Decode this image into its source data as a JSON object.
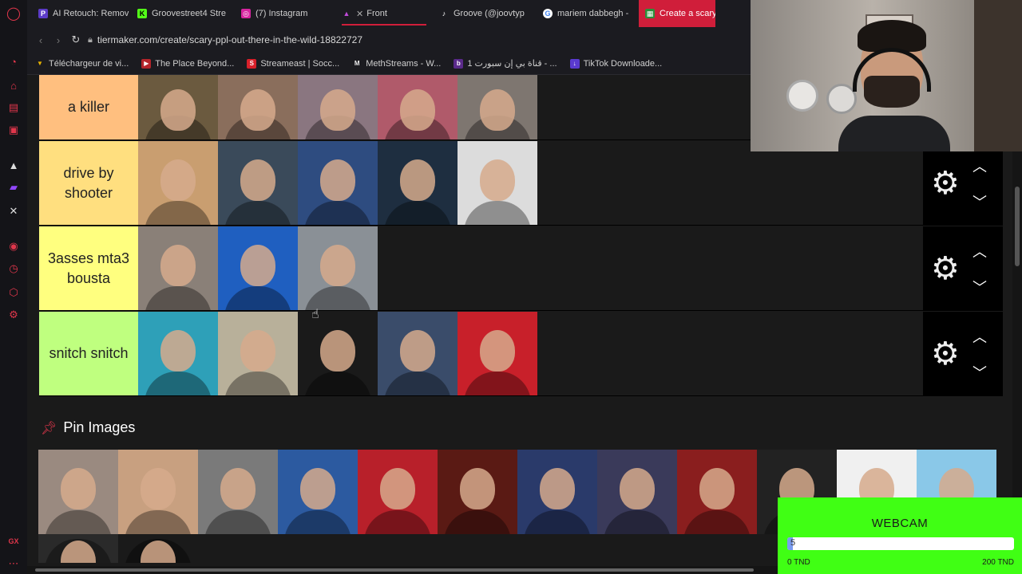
{
  "browser": {
    "tabs": [
      {
        "label": "AI Retouch: Remov",
        "icon": "picsart-icon",
        "color": "#5c3cc8"
      },
      {
        "label": "Groovestreet4 Stre",
        "icon": "kick-icon",
        "color": "#53fc18"
      },
      {
        "label": "(7) Instagram",
        "icon": "instagram-icon",
        "color": "#d6249f"
      },
      {
        "label": "Front",
        "icon": "front-icon",
        "color": "#c04ad8"
      },
      {
        "label": "Groove (@joovtyp",
        "icon": "tiktok-icon",
        "color": "#111111"
      },
      {
        "label": "mariem dabbegh -",
        "icon": "google-icon",
        "color": "#4285f4"
      },
      {
        "label": "Create a scary",
        "icon": "tiermaker-icon",
        "color": "#2d8f3a"
      }
    ],
    "url": "tiermaker.com/create/scary-ppl-out-there-in-the-wild-18822727",
    "bookmarks": [
      {
        "label": "Téléchargeur de vi...",
        "icon": "vidiq-icon",
        "color": "#e8b400"
      },
      {
        "label": "The Place Beyond...",
        "icon": "movie-icon",
        "color": "#b3242a"
      },
      {
        "label": "Streameast | Socc...",
        "icon": "streameast-icon",
        "color": "#d8202a"
      },
      {
        "label": "MethStreams - W...",
        "icon": "m-icon",
        "color": "#222"
      },
      {
        "label": "قناة بي إن سبورت 1 - ...",
        "icon": "bein-icon",
        "color": "#5a2a8a"
      },
      {
        "label": "TikTok Downloade...",
        "icon": "download-icon",
        "color": "#5a3ad0"
      }
    ]
  },
  "tiers": [
    {
      "label": "a killer",
      "color": "#ffbf7f",
      "images": [
        "#6b5a3f",
        "#8a6e5c",
        "#8a7680",
        "#b05a6a",
        "#7e7670"
      ]
    },
    {
      "label": "drive by shooter",
      "color": "#ffdf7f",
      "images": [
        "#c99e70",
        "#3a4a5a",
        "#2e4c80",
        "#1e2e40",
        "#dcdcdc"
      ]
    },
    {
      "label": "3asses mta3 bousta",
      "color": "#ffff7f",
      "images": [
        "#8a8078",
        "#1f5fc0",
        "#8a9096"
      ]
    },
    {
      "label": "snitch snitch",
      "color": "#bfff7f",
      "images": [
        "#2ea0b8",
        "#b8b09a",
        "#1a1a1a",
        "#3a4c6a",
        "#c8202a"
      ]
    }
  ],
  "pin_section": {
    "title": "Pin Images",
    "images_row1": [
      "#9a8a80",
      "#c8a080",
      "#7a7a7a",
      "#2c5aa0",
      "#b8202a",
      "#5a1a14",
      "#2a3a6a",
      "#3a3a5a",
      "#8a1e1e",
      "#222222",
      "#f0f0f0",
      "#8ac8e8"
    ],
    "images_row2": [
      "#2a2a2a",
      "#1a1a1a"
    ]
  },
  "donation_goal": {
    "title": "WEBCAM",
    "current": "5",
    "progress_fraction": 0.025,
    "min_label": "0 TND",
    "max_label": "200 TND"
  }
}
